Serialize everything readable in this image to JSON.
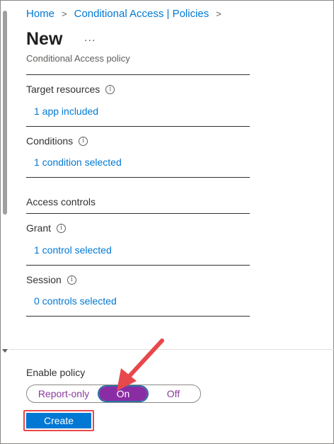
{
  "breadcrumb": {
    "home": "Home",
    "policies": "Conditional Access | Policies",
    "separator": ">"
  },
  "header": {
    "title": "New",
    "more": "...",
    "subtitle": "Conditional Access policy"
  },
  "sections": {
    "target_resources": {
      "label": "Target resources",
      "value": "1 app included"
    },
    "conditions": {
      "label": "Conditions",
      "value": "1 condition selected"
    },
    "access_controls": {
      "label": "Access controls"
    },
    "grant": {
      "label": "Grant",
      "value": "1 control selected"
    },
    "session": {
      "label": "Session",
      "value": "0 controls selected"
    }
  },
  "info_glyph": "i",
  "footer": {
    "enable_label": "Enable policy",
    "options": [
      "Report-only",
      "On",
      "Off"
    ],
    "selected": "On",
    "create_label": "Create"
  },
  "colors": {
    "link": "#0078d4",
    "toggle_selected": "#8a2da5",
    "annotation": "#e8474b"
  }
}
